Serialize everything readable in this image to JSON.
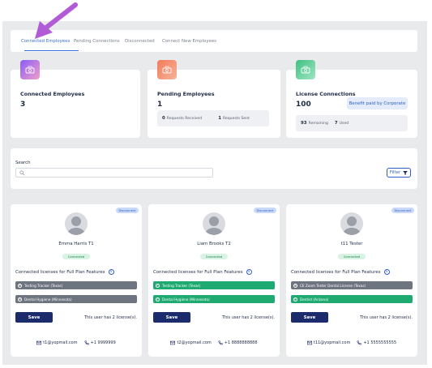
{
  "tabs": [
    {
      "label": "Connected Employees",
      "active": true
    },
    {
      "label": "Pending Connections",
      "active": false
    },
    {
      "label": "Disconnected",
      "active": false
    },
    {
      "label": "Connect New Employees",
      "active": false
    }
  ],
  "annotation": {
    "icon": "arrow-pointer-icon",
    "color": "#b25bd6"
  },
  "stats": {
    "connected": {
      "label": "Connected Employees",
      "value": "3",
      "icon": "users-icon",
      "gradient": [
        "#8b5cf6",
        "#f0a0c8"
      ]
    },
    "pending": {
      "label": "Pending Employees",
      "value": "1",
      "icon": "users-icon",
      "gradient": [
        "#f47a5a",
        "#f5b39a"
      ],
      "received_value": "0",
      "received_label": "Requests Received",
      "sent_value": "1",
      "sent_label": "Requests Sent"
    },
    "license": {
      "label": "License Connections",
      "value": "100",
      "icon": "users-icon",
      "gradient": [
        "#3fbf7f",
        "#9fe6c4"
      ],
      "button": "Benefit paid by Corporate",
      "remaining_value": "93",
      "remaining_label": "Remaining",
      "used_value": "7",
      "used_label": "Used"
    }
  },
  "search": {
    "label": "Search",
    "placeholder": "",
    "filter_label": "Filter"
  },
  "employees": [
    {
      "name": "Emma Harris T1",
      "status": "Connected",
      "disconnect_label": "Disconnect",
      "licenses_title": "Connected licenses for Full Plan Features",
      "licenses": [
        {
          "label": "Testing Tracker (Texas)",
          "state": "grey"
        },
        {
          "label": "Dental Hygiene (Minnesota)",
          "state": "grey"
        }
      ],
      "save_label": "Save",
      "license_count": "This user has 2 license(s).",
      "email": "t1@yopmail.com",
      "phone": "+1 9999999"
    },
    {
      "name": "Liam Brooks T2",
      "status": "Connected",
      "disconnect_label": "Disconnect",
      "licenses_title": "Connected licenses for Full Plan Features",
      "licenses": [
        {
          "label": "Testing Tracker (Texas)",
          "state": "green"
        },
        {
          "label": "Dental Hygiene (Minnesota)",
          "state": "green"
        }
      ],
      "save_label": "Save",
      "license_count": "This user has 2 license(s).",
      "email": "t2@yopmail.com",
      "phone": "+1 8888888888"
    },
    {
      "name": "t11 Tester",
      "status": "Connected",
      "disconnect_label": "Disconnect",
      "licenses_title": "Connected licenses for Full Plan Features",
      "licenses": [
        {
          "label": "CE Zoom Tester Dental License (Texas)",
          "state": "grey"
        },
        {
          "label": "Dentist (Arizona)",
          "state": "green"
        }
      ],
      "save_label": "Save",
      "license_count": "This user has 2 license(s).",
      "email": "t11@yopmail.com",
      "phone": "+1 5555555555"
    }
  ],
  "colors": {
    "accent": "#3b6fd6",
    "save": "#1c2b6b",
    "connected_green": "#1faa72",
    "inactive_grey": "#6e7480"
  }
}
